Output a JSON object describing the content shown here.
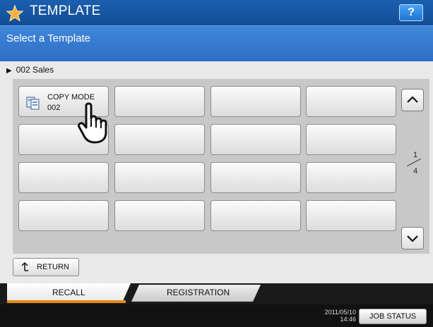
{
  "header": {
    "title": "TEMPLATE",
    "help_label": "?",
    "subtitle": "Select a Template"
  },
  "breadcrumb": {
    "marker": "▶",
    "text": "002 Sales"
  },
  "templates": {
    "rows": 4,
    "cols": 4,
    "filled": [
      {
        "line1": "COPY MODE",
        "line2": "002",
        "icon": "copy-mode-icon"
      }
    ]
  },
  "pager": {
    "current": "1",
    "total": "4",
    "up_icon": "chevron-up-icon",
    "down_icon": "chevron-down-icon"
  },
  "return_button": {
    "label": "RETURN"
  },
  "tabs": [
    {
      "label": "RECALL",
      "active": true
    },
    {
      "label": "REGISTRATION",
      "active": false
    }
  ],
  "status": {
    "date": "2011/05/10",
    "time": "14:46",
    "job_status_label": "JOB STATUS"
  },
  "colors": {
    "title_bar": "#134d95",
    "subtitle_band": "#2e6fc6",
    "active_tab_underline": "#e88a17",
    "star": "#f5b13a"
  }
}
